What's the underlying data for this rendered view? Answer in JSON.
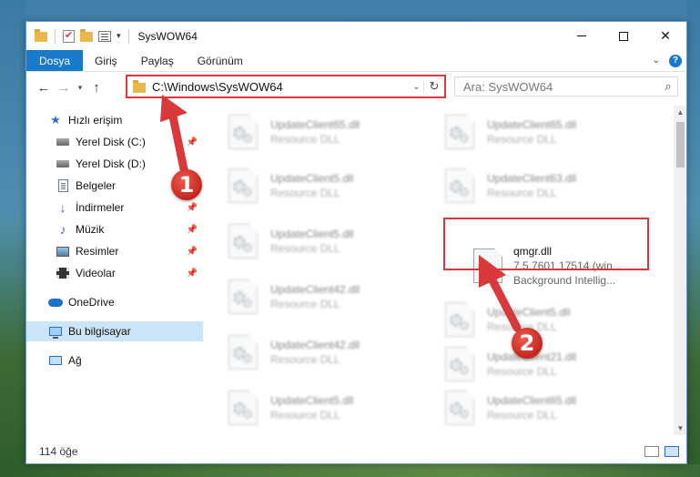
{
  "window": {
    "title": "SysWOW64",
    "qat_dropdown": "▾",
    "controls": {
      "minimize": "–",
      "maximize": "□",
      "close": "✕"
    }
  },
  "ribbon": {
    "tabs": [
      {
        "label": "Dosya"
      },
      {
        "label": "Giriş"
      },
      {
        "label": "Paylaş"
      },
      {
        "label": "Görünüm"
      }
    ],
    "help": "?"
  },
  "nav": {
    "back": "←",
    "forward": "→",
    "recent": "▾",
    "up": "↑",
    "address": "C:\\Windows\\SysWOW64",
    "search_placeholder": "Ara: SysWOW64"
  },
  "sidebar": {
    "items": [
      {
        "label": "Hızlı erişim",
        "icon": "star-icon"
      },
      {
        "label": "Yerel Disk (C:)",
        "icon": "drive-icon"
      },
      {
        "label": "Yerel Disk (D:)",
        "icon": "drive-icon"
      },
      {
        "label": "Belgeler",
        "icon": "documents-icon"
      },
      {
        "label": "İndirmeler",
        "icon": "downloads-icon"
      },
      {
        "label": "Müzik",
        "icon": "music-icon"
      },
      {
        "label": "Resimler",
        "icon": "pictures-icon"
      },
      {
        "label": "Videolar",
        "icon": "videos-icon"
      },
      {
        "label": "OneDrive",
        "icon": "onedrive-icon"
      },
      {
        "label": "Bu bilgisayar",
        "icon": "this-pc-icon"
      },
      {
        "label": "Ağ",
        "icon": "network-icon"
      }
    ]
  },
  "files": {
    "left": [
      {
        "name": "UpdateClient65.dll",
        "desc": "Resource DLL"
      },
      {
        "name": "UpdateClient5.dll",
        "desc": "Resource DLL"
      },
      {
        "name": "UpdateClient5.dll",
        "desc": "Resource DLL"
      },
      {
        "name": "UpdateClient42.dll",
        "desc": "Resource DLL"
      },
      {
        "name": "UpdateClient42.dll",
        "desc": "Resource DLL"
      },
      {
        "name": "UpdateClient5.dll",
        "desc": "Resource DLL"
      }
    ],
    "right": [
      {
        "name": "UpdateClient65.dll",
        "desc": "Resource DLL"
      },
      {
        "name": "UpdateClient63.dll",
        "desc": "Resource DLL"
      },
      {
        "name": "qmgr.dll",
        "version": "7.5.7601.17514 (win...",
        "desc": "Background Intellig..."
      },
      {
        "name": "UpdateClient5.dll",
        "desc": "Resource DLL"
      },
      {
        "name": "UpdateClient21.dll",
        "desc": "Resource DLL"
      },
      {
        "name": "UpdateClient65.dll",
        "desc": "Resource DLL"
      }
    ]
  },
  "status": {
    "count": "114 öğe"
  },
  "annotations": {
    "step1": "1",
    "step2": "2"
  },
  "colors": {
    "accent": "#1979ca",
    "highlight": "#d9393b",
    "selected": "#cce4f7"
  }
}
